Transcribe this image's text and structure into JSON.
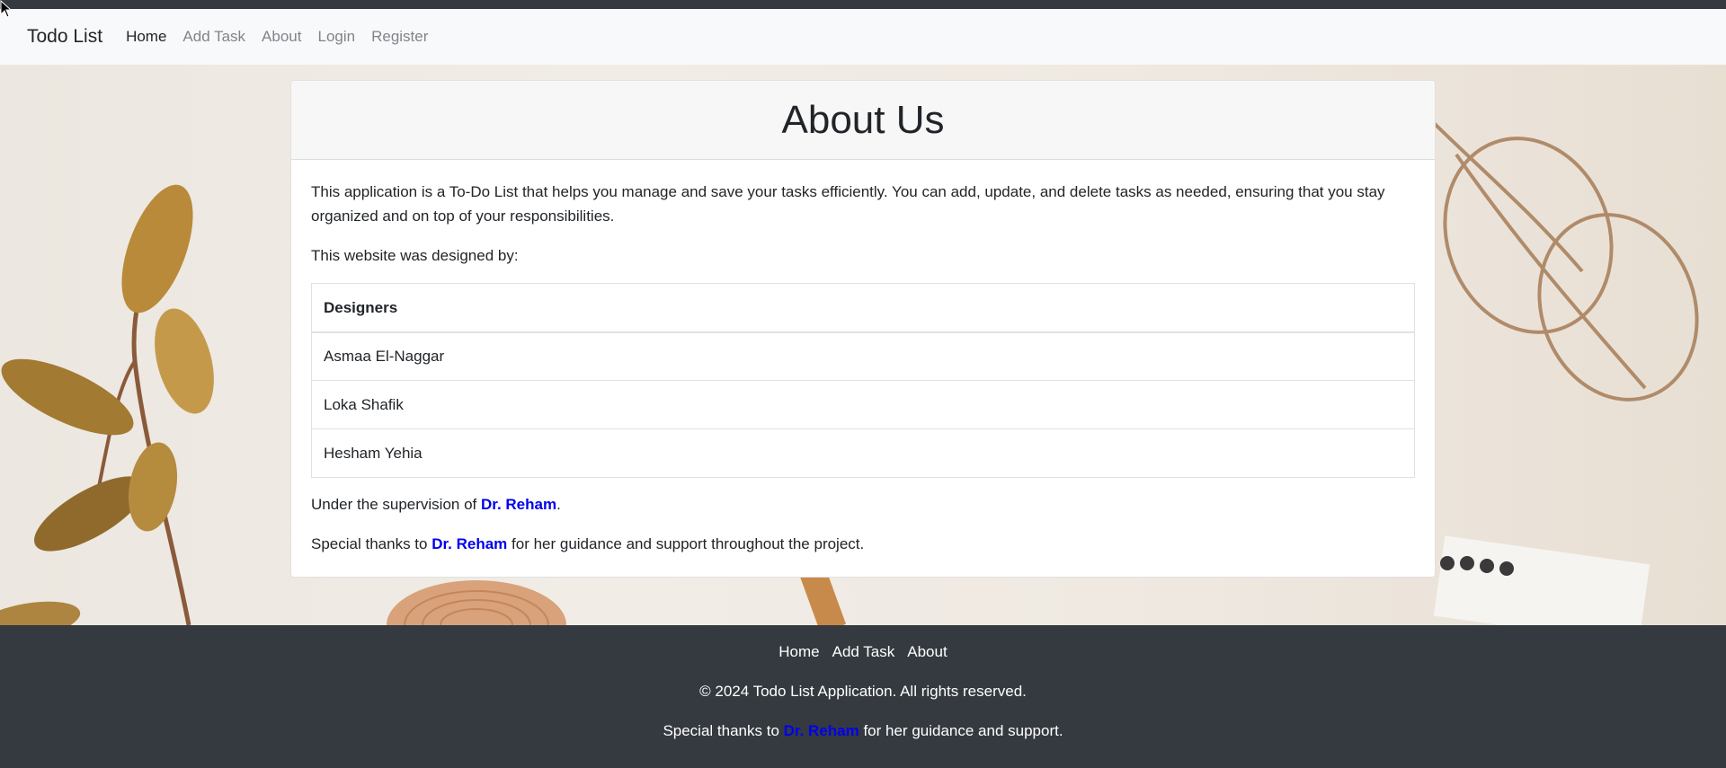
{
  "navbar": {
    "brand": "Todo List",
    "links": [
      {
        "label": "Home",
        "active": true
      },
      {
        "label": "Add Task",
        "active": false
      },
      {
        "label": "About",
        "active": false
      },
      {
        "label": "Login",
        "active": false
      },
      {
        "label": "Register",
        "active": false
      }
    ]
  },
  "about": {
    "title": "About Us",
    "intro": "This application is a To-Do List that helps you manage and save your tasks efficiently. You can add, update, and delete tasks as needed, ensuring that you stay organized and on top of your responsibilities.",
    "designed_by": "This website was designed by:",
    "table": {
      "header": "Designers",
      "rows": [
        "Asmaa El-Naggar",
        "Loka Shafik",
        "Hesham Yehia"
      ]
    },
    "supervision": {
      "prefix": "Under the supervision of ",
      "name": "Dr. Reham",
      "suffix": "."
    },
    "thanks": {
      "prefix": "Special thanks to ",
      "name": "Dr. Reham",
      "suffix": " for her guidance and support throughout the project."
    }
  },
  "footer": {
    "links": [
      "Home",
      "Add Task",
      "About"
    ],
    "copyright": "© 2024 Todo List Application. All rights reserved.",
    "thanks": {
      "prefix": "Special thanks to ",
      "name": "Dr. Reham",
      "suffix": " for her guidance and support."
    }
  },
  "colors": {
    "dark": "#343a40",
    "navbar_bg": "#f8f9fa",
    "highlight": "#0000ee"
  }
}
